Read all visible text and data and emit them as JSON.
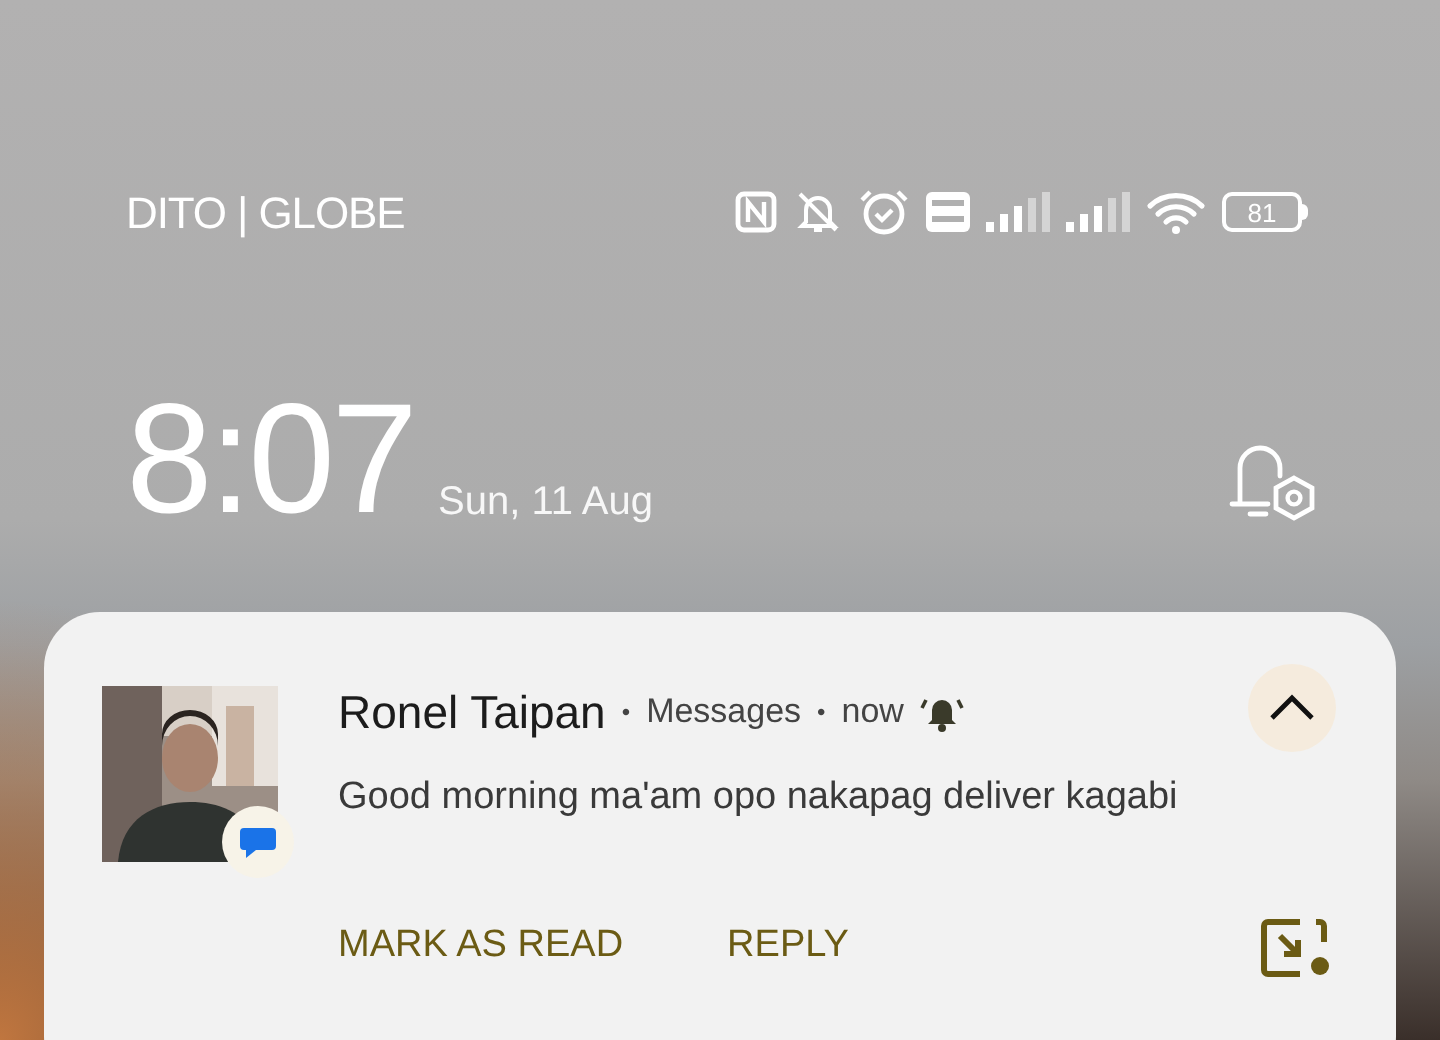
{
  "status_bar": {
    "carrier": "DITO | GLOBE",
    "battery": "81"
  },
  "lock_screen": {
    "time": "8:07",
    "date": "Sun, 11 Aug"
  },
  "notification": {
    "sender": "Ronel Taipan",
    "separators": [
      "•",
      "•"
    ],
    "app": "Messages",
    "time": "now",
    "alerting": true,
    "expanded": true,
    "message": "Good morning ma'am opo nakapag deliver kagabi",
    "actions": [
      "MARK AS READ",
      "REPLY"
    ]
  }
}
